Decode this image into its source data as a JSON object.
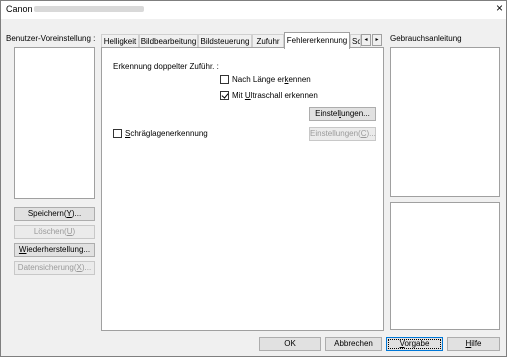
{
  "window": {
    "title": "Canon",
    "close_label": "×"
  },
  "left_panel": {
    "label": "Benutzer-Voreinstellung :",
    "buttons": [
      {
        "label": "Speichern(Y)...",
        "enabled": true
      },
      {
        "label": "Löschen(U)",
        "enabled": false
      },
      {
        "label": "Wiederherstellung...",
        "enabled": true
      },
      {
        "label": "Datensicherung(X)...",
        "enabled": false
      }
    ]
  },
  "tabs": [
    {
      "label": "Helligkeit",
      "active": false
    },
    {
      "label": "Bildbearbeitung",
      "active": false
    },
    {
      "label": "Bildsteuerung",
      "active": false
    },
    {
      "label": "Zufuhr",
      "active": false
    },
    {
      "label": "Fehlererkennung",
      "active": true
    },
    {
      "label": "Sc",
      "active": false
    }
  ],
  "tab_scroll": {
    "left": "◂",
    "right": "▸"
  },
  "fehlererkennung": {
    "double_feed_label": "Erkennung doppelter Zuführ. :",
    "by_length": {
      "label": "Nach Länge erkennen",
      "checked": false
    },
    "by_ultrasonic": {
      "label": "Mit Ultraschall erkennen",
      "checked": true
    },
    "settings_button_1": "Einstellungen...",
    "skew_detection": {
      "label": "Schräglagenerkennung",
      "checked": false
    },
    "settings_button_2": "Einstellungen(C)..."
  },
  "help_panel": {
    "label": "Gebrauchsanleitung"
  },
  "footer": {
    "ok": "OK",
    "cancel": "Abbrechen",
    "default": "Vorgabe",
    "help": "Hilfe"
  }
}
